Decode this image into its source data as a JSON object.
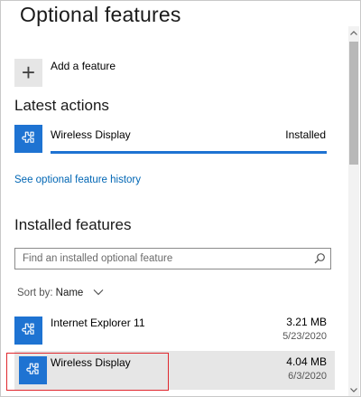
{
  "page": {
    "title": "Optional features"
  },
  "add_feature": {
    "label": "Add a feature",
    "icon": "plus-icon"
  },
  "latest_actions": {
    "heading": "Latest actions",
    "item": {
      "name": "Wireless Display",
      "status": "Installed",
      "icon": "puzzle-piece-icon",
      "progress": 1.0
    }
  },
  "history_link": "See optional feature history",
  "installed": {
    "heading": "Installed features",
    "search_placeholder": "Find an installed optional feature",
    "sort": {
      "label": "Sort by:",
      "value": "Name"
    },
    "items": [
      {
        "name": "Internet Explorer 11",
        "size": "3.21 MB",
        "date": "5/23/2020",
        "icon": "puzzle-piece-icon"
      },
      {
        "name": "Wireless Display",
        "size": "4.04 MB",
        "date": "6/3/2020",
        "icon": "puzzle-piece-icon",
        "selected": true
      }
    ]
  },
  "colors": {
    "accent": "#1e73d2",
    "link": "#0066b4",
    "highlight_box": "#e0282e",
    "selected_row": "#e6e6e6"
  }
}
